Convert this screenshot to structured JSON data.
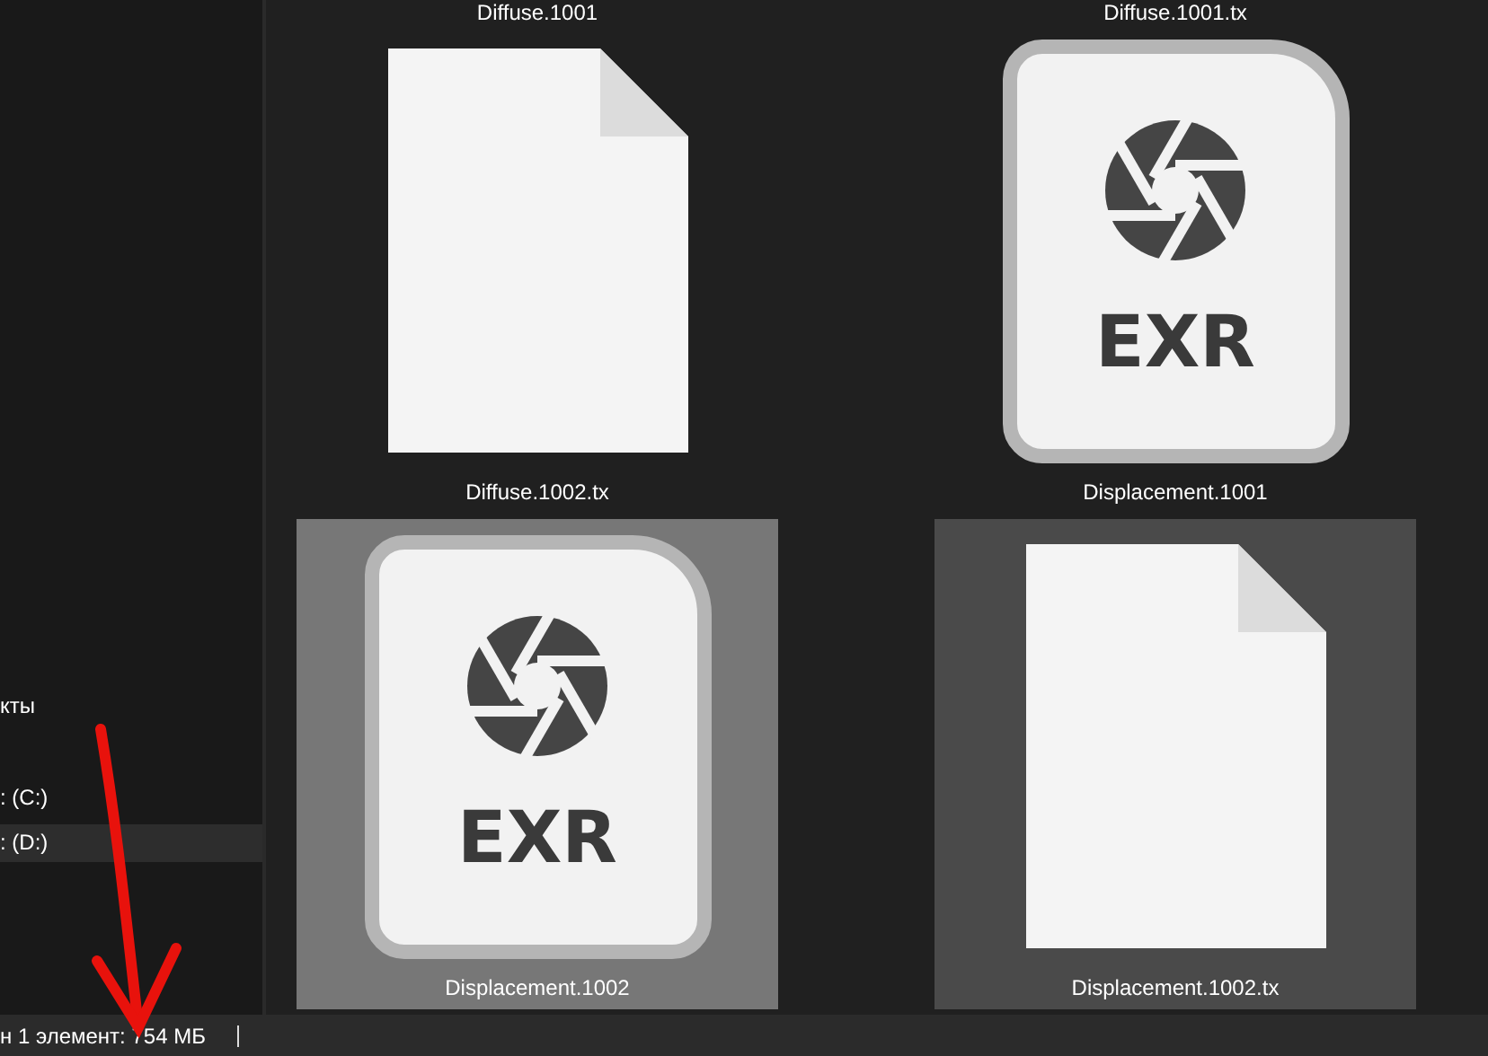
{
  "sidebar": {
    "items": [
      {
        "label": "кты",
        "selected": false
      },
      {
        "label": ": (C:)",
        "selected": false
      },
      {
        "label": ": (D:)",
        "selected": true
      }
    ]
  },
  "files_partial_row": [
    "Diffuse.1001",
    "Diffuse.1001.tx"
  ],
  "files": [
    {
      "name": "Diffuse.1002.tx",
      "kind": "blank",
      "selected": false,
      "hovered": false
    },
    {
      "name": "Displacement.1001",
      "kind": "exr",
      "badge": "EXR",
      "selected": false,
      "hovered": false
    },
    {
      "name": "Displacement.1002",
      "kind": "exr",
      "badge": "EXR",
      "selected": true,
      "hovered": false
    },
    {
      "name": "Displacement.1002.tx",
      "kind": "blank",
      "selected": false,
      "hovered": true
    }
  ],
  "status_bar": {
    "text": "н 1 элемент: 754 МБ"
  }
}
